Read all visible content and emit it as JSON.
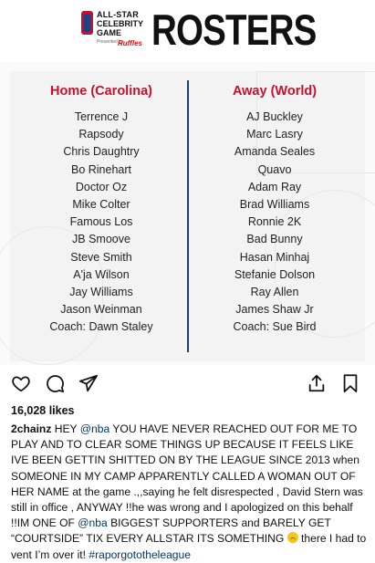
{
  "graphic": {
    "logo": {
      "line1": "ALL-STAR",
      "line2": "CELEBRITY",
      "line3": "GAME",
      "presented_by": "Presented by",
      "sponsor": "Ruffles"
    },
    "title": "ROSTERS",
    "home": {
      "heading": "Home (Carolina)",
      "players": [
        "Terrence J",
        "Rapsody",
        "Chris Daughtry",
        "Bo Rinehart",
        "Doctor Oz",
        "Mike Colter",
        "Famous Los",
        "JB Smoove",
        "Steve Smith",
        "A'ja Wilson",
        "Jay Williams",
        "Jason Weinman",
        "Coach: Dawn Staley"
      ]
    },
    "away": {
      "heading": "Away (World)",
      "players": [
        "AJ Buckley",
        "Marc Lasry",
        "Amanda Seales",
        "Quavo",
        "Adam Ray",
        "Brad Williams",
        "Ronnie 2K",
        "Bad Bunny",
        "Hasan Minhaj",
        "Stefanie Dolson",
        "Ray Allen",
        "James Shaw Jr",
        "Coach: Sue Bird"
      ]
    }
  },
  "post": {
    "likes": "16,028 likes",
    "username": "2chainz",
    "caption_parts": [
      " HEY ",
      "@nba",
      " YOU HAVE NEVER REACHED OUT FOR ME TO PLAY AND TO CLEAR SOME THINGS UP BECAUSE IT FEELS LIKE IVE BEEN GETTIN SHITTED ON BY THE LEAGUE  SINCE 2013 when SOMEONE IN MY CAMP APPARENTLY CALLED A WOMAN OUT OF HER NAME at the game .,,saying he felt disrespected , David Stern was still in office , ANYWAY !!he was wrong and I apologized on this behalf !!IM ONE OF ",
      "@nba",
      " BIGGEST SUPPORTERS and BARELY GET “COURTSIDE” TIX EVERY ALLSTAR ITS SOMETHING ",
      " there I had to vent I’m over it! ",
      "#raporgotothe league"
    ],
    "hashtag": "#raporgotothe​league"
  },
  "icons": {
    "heart": "heart-icon",
    "comment": "comment-icon",
    "share": "share-icon",
    "upload": "upload-icon",
    "bookmark": "bookmark-icon",
    "emoji": "grimacing-face-emoji"
  }
}
